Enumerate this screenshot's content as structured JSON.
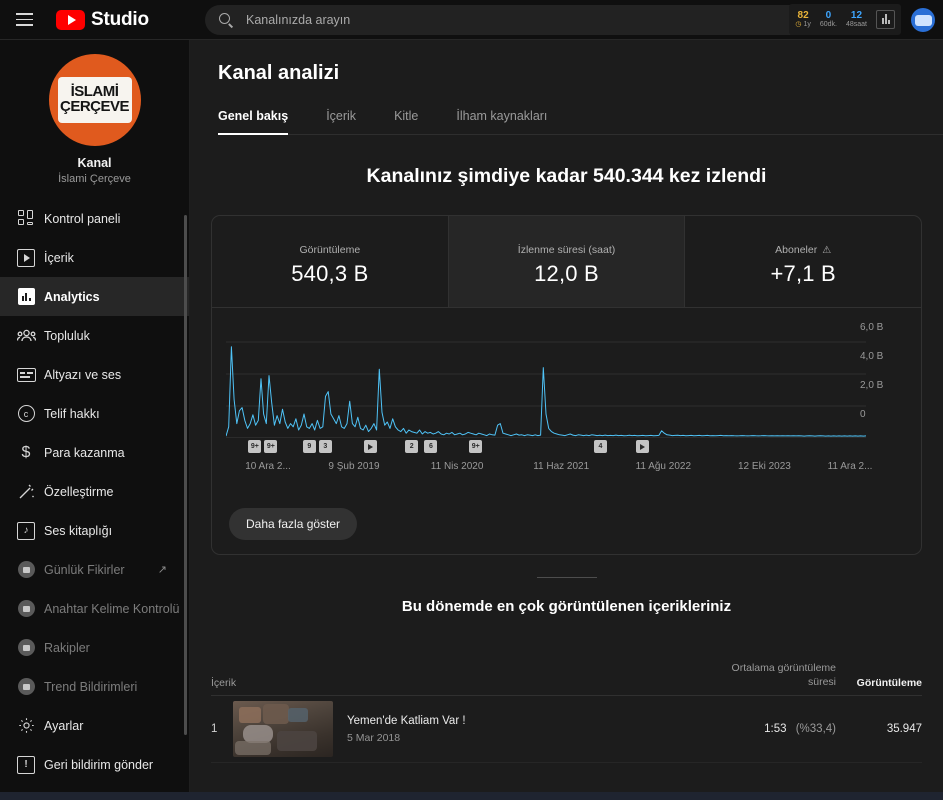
{
  "topbar": {
    "menu_icon": "hamburger-icon",
    "logo_icon": "youtube-logo-icon",
    "brand": "Studio",
    "search": {
      "icon": "search-icon",
      "placeholder": "Kanalınızda arayın",
      "value": ""
    },
    "stats": [
      {
        "num": "82",
        "label": "1y",
        "clock_icon": "clock-icon",
        "color": "#e8b339"
      },
      {
        "num": "0",
        "label": "60dk.",
        "color": "#3ea6ff"
      },
      {
        "num": "12",
        "label": "48saat",
        "color": "#3ea6ff"
      }
    ],
    "chart_button_icon": "bar-chart-icon",
    "avatar_icon": "account-avatar"
  },
  "sidebar": {
    "channel": {
      "avatar_line1": "İSLAMİ",
      "avatar_line2": "ÇERÇEVE",
      "role": "Kanal",
      "name": "İslami Çerçeve",
      "avatar_bg": "#e05a1e"
    },
    "items": [
      {
        "label": "Kontrol paneli",
        "icon": "dashboard-icon",
        "state": "normal"
      },
      {
        "label": "İçerik",
        "icon": "video-icon",
        "state": "normal"
      },
      {
        "label": "Analytics",
        "icon": "analytics-icon",
        "state": "active"
      },
      {
        "label": "Topluluk",
        "icon": "community-icon",
        "state": "normal"
      },
      {
        "label": "Altyazı ve ses",
        "icon": "subtitles-icon",
        "state": "normal"
      },
      {
        "label": "Telif hakkı",
        "icon": "copyright-icon",
        "state": "normal"
      },
      {
        "label": "Para kazanma",
        "icon": "monetization-icon",
        "state": "normal"
      },
      {
        "label": "Özelleştirme",
        "icon": "customization-wand-icon",
        "state": "normal"
      },
      {
        "label": "Ses kitaplığı",
        "icon": "audio-library-icon",
        "state": "normal"
      },
      {
        "label": "Günlük Fikirler",
        "icon": "extension-icon",
        "state": "dim",
        "external": "↗"
      },
      {
        "label": "Anahtar Kelime Kontrolü",
        "icon": "extension-icon",
        "state": "dim"
      },
      {
        "label": "Rakipler",
        "icon": "extension-icon",
        "state": "dim"
      },
      {
        "label": "Trend Bildirimleri",
        "icon": "extension-icon",
        "state": "dim"
      },
      {
        "label": "Ayarlar",
        "icon": "gear-icon",
        "state": "normal"
      },
      {
        "label": "Geri bildirim gönder",
        "icon": "feedback-icon",
        "state": "normal"
      }
    ]
  },
  "main": {
    "page_title": "Kanal analizi",
    "tabs": [
      {
        "label": "Genel bakış",
        "active": true
      },
      {
        "label": "İçerik",
        "active": false
      },
      {
        "label": "Kitle",
        "active": false
      },
      {
        "label": "İlham kaynakları",
        "active": false
      }
    ],
    "headline": "Kanalınız şimdiye kadar 540.344 kez izlendi",
    "metrics": [
      {
        "label": "Görüntüleme",
        "value": "540,3 B",
        "selected": false,
        "warning": false
      },
      {
        "label": "İzlenme süresi (saat)",
        "value": "12,0 B",
        "selected": true,
        "warning": false
      },
      {
        "label": "Aboneler",
        "value": "+7,1 B",
        "selected": false,
        "warning": true,
        "warning_icon": "warning-triangle-icon"
      }
    ],
    "show_more_label": "Daha fazla göster",
    "table_title": "Bu dönemde en çok görüntülenen içerikleriniz",
    "table_headers": {
      "content": "İçerik",
      "avg_duration": "Ortalama görüntüleme süresi",
      "views": "Görüntüleme"
    },
    "rows": [
      {
        "rank": "1",
        "title": "Yemen'de Katliam Var !",
        "date": "5 Mar 2018",
        "avg_duration": "1:53",
        "avg_pct": "(%33,4)",
        "views": "35.947",
        "thumbnail": "video-thumbnail"
      }
    ]
  },
  "chart_data": {
    "type": "line",
    "title": "",
    "xlabel": "",
    "ylabel": "",
    "line_color": "#4fc3f7",
    "grid": true,
    "legend": false,
    "ylim": [
      0,
      7000
    ],
    "yticks": [
      0,
      2000,
      4000,
      6000
    ],
    "ytick_labels": [
      "0",
      "2,0 B",
      "4,0 B",
      "6,0 B"
    ],
    "xtick_labels": [
      "10 Ara 2...",
      "9 Şub 2019",
      "11 Nis 2020",
      "11 Haz 2021",
      "11 Ağu 2022",
      "12 Eki 2023",
      "11 Ara 2..."
    ],
    "x_positions_pct": [
      3,
      16,
      32,
      48,
      64,
      80,
      94
    ],
    "annotations": [
      {
        "label": "9+",
        "x_pct": 3.5
      },
      {
        "label": "9+",
        "x_pct": 6.0
      },
      {
        "label": "9",
        "x_pct": 12.0
      },
      {
        "label": "3",
        "x_pct": 14.5
      },
      {
        "label": "play",
        "x_pct": 21.5
      },
      {
        "label": "2",
        "x_pct": 28.0
      },
      {
        "label": "6",
        "x_pct": 31.0
      },
      {
        "label": "9+",
        "x_pct": 38.0
      },
      {
        "label": "4",
        "x_pct": 57.5
      },
      {
        "label": "play",
        "x_pct": 64.0
      }
    ],
    "values": [
      120,
      700,
      5700,
      2400,
      900,
      1700,
      1900,
      1100,
      600,
      900,
      1450,
      800,
      1100,
      3700,
      1500,
      900,
      3900,
      2200,
      800,
      1400,
      900,
      1800,
      1000,
      600,
      900,
      700,
      1200,
      500,
      800,
      1500,
      700,
      600,
      900,
      500,
      1100,
      600,
      700,
      2600,
      2900,
      1500,
      1200,
      900,
      1400,
      700,
      600,
      900,
      2300,
      900,
      700,
      1300,
      600,
      500,
      800,
      400,
      600,
      900,
      500,
      4300,
      1600,
      800,
      1000,
      600,
      1200,
      700,
      500,
      400,
      600,
      300,
      500,
      400,
      350,
      300,
      500,
      250,
      400,
      300,
      350,
      250,
      300,
      400,
      250,
      200,
      300,
      250,
      350,
      200,
      250,
      300,
      200,
      250,
      350,
      300,
      250,
      200,
      300,
      250,
      200,
      150,
      250,
      200,
      180,
      800,
      900,
      300,
      250,
      200,
      150,
      200,
      250,
      180,
      200,
      150,
      200,
      180,
      150,
      200,
      150,
      180,
      4400,
      1500,
      600,
      400,
      300,
      250,
      200,
      180,
      150,
      200,
      250,
      180,
      150,
      200,
      180,
      150,
      180,
      150,
      200,
      180,
      150,
      170,
      150,
      180,
      150,
      160,
      150,
      180,
      150,
      160,
      140,
      150,
      170,
      150,
      160,
      140,
      150,
      160,
      140,
      150,
      160,
      140,
      150,
      160,
      450,
      300,
      200,
      180,
      150,
      160,
      170,
      150,
      160,
      140,
      150,
      160,
      140,
      150,
      160,
      140,
      150,
      160,
      140,
      150,
      140,
      150,
      160,
      140,
      150,
      140,
      150,
      140,
      130,
      140,
      150,
      140,
      130,
      140,
      150,
      140,
      130,
      140,
      150,
      140,
      130,
      140,
      130,
      140,
      130,
      140,
      130,
      140,
      130,
      140,
      130,
      140,
      130,
      120,
      130,
      140,
      130,
      120,
      130,
      140,
      130,
      120,
      130,
      120,
      130,
      120,
      130,
      120,
      130,
      120,
      130,
      120,
      130,
      120,
      130,
      120,
      130
    ]
  }
}
